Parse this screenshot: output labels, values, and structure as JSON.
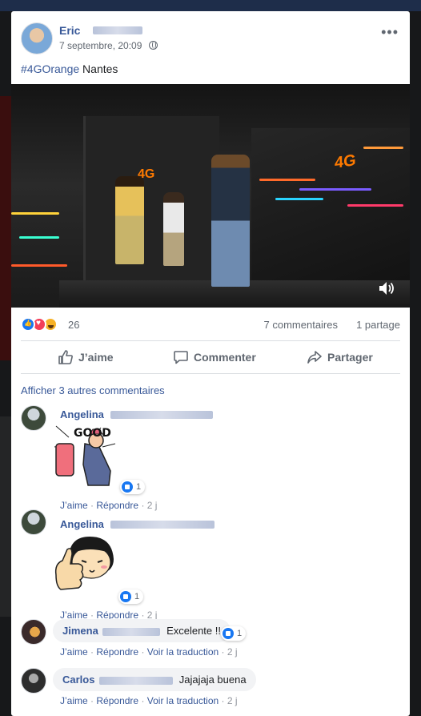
{
  "post": {
    "author": "Eric",
    "timestamp": "7 septembre, 20:09",
    "privacy_icon": "globe-icon",
    "text_hashtag": "#4GOrange",
    "text_rest": " Nantes",
    "video": {
      "brand_text_left": "4G",
      "brand_text_right": "4G",
      "sound_icon": "speaker-icon"
    }
  },
  "reactions": {
    "types": [
      "like",
      "love",
      "haha"
    ],
    "count": "26",
    "comments": "7 commentaires",
    "shares": "1 partage"
  },
  "actions": {
    "like": "J’aime",
    "comment": "Commenter",
    "share": "Partager"
  },
  "comments_section": {
    "more_link": "Afficher 3 autres commentaires",
    "items": [
      {
        "name": "Angelina",
        "sticker": "good-thumbs-up-sticker",
        "sticker_text": "GOOD",
        "likes": "1",
        "like_label": "J’aime",
        "reply_label": "Répondre",
        "time": "2 j"
      },
      {
        "name": "Angelina",
        "sticker": "thumbs-up-girl-sticker",
        "likes": "1",
        "like_label": "J’aime",
        "reply_label": "Répondre",
        "time": "2 j"
      },
      {
        "name": "Jimena",
        "text": "Excelente !!",
        "likes": "1",
        "like_label": "J’aime",
        "reply_label": "Répondre",
        "translate_label": "Voir la traduction",
        "time": "2 j"
      },
      {
        "name": "Carlos",
        "text": "Jajajaja buena",
        "like_label": "J’aime",
        "reply_label": "Répondre",
        "translate_label": "Voir la traduction",
        "time": "2 j"
      }
    ]
  },
  "colors": {
    "link": "#385898",
    "secondary_text": "#606770",
    "like_blue": "#1877f2",
    "love_red": "#f33e58",
    "haha_yellow": "#f7b125",
    "brand_orange": "#ff7a00"
  }
}
